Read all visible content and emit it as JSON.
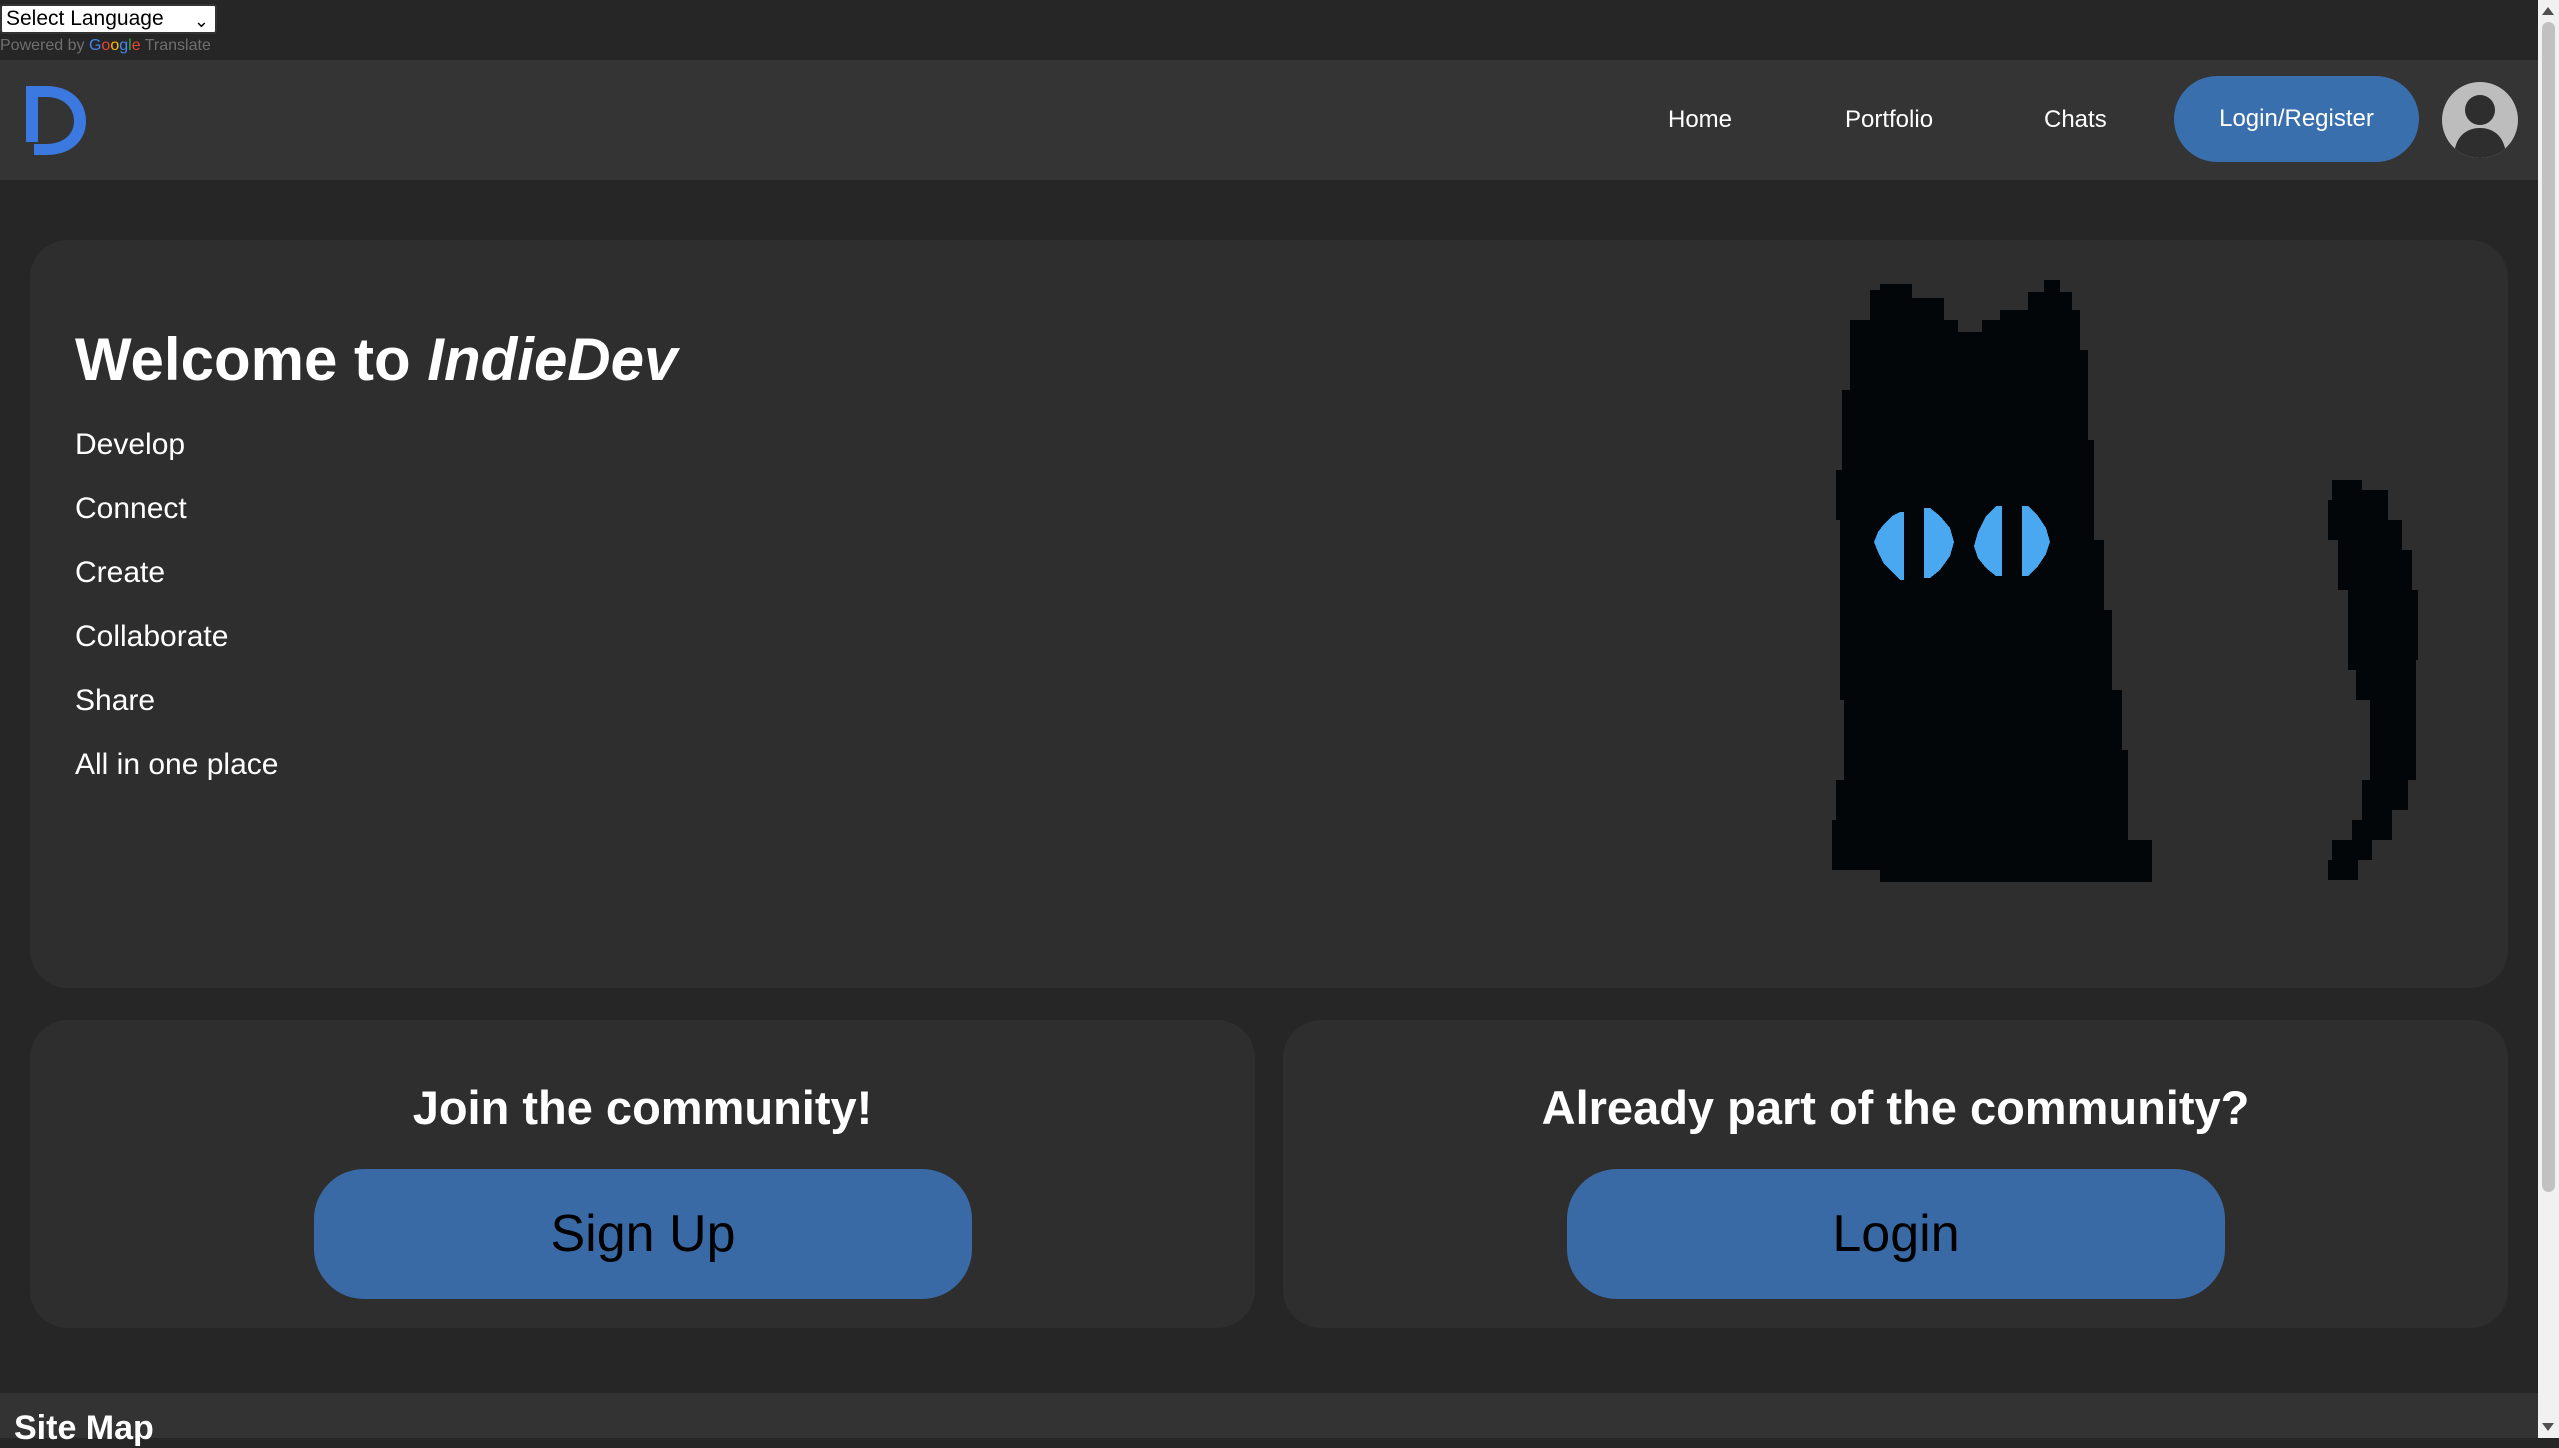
{
  "translate": {
    "select_label": "Select Language",
    "powered_by": "Powered by",
    "google_letters": [
      "G",
      "o",
      "o",
      "g",
      "l",
      "e"
    ],
    "translate_word": "Translate"
  },
  "nav": {
    "logo_icon": "indiedev-d-logo-icon",
    "links": [
      "Home",
      "Portfolio",
      "Chats"
    ],
    "login_register": "Login/Register",
    "avatar_icon": "user-avatar-icon",
    "accent_color": "#3a6fae"
  },
  "hero": {
    "title_prefix": "Welcome to ",
    "title_brand": "IndieDev",
    "features": [
      "Develop",
      "Connect",
      "Create",
      "Collaborate",
      "Share",
      "All in one place"
    ],
    "mascot_icon": "pixel-cat-icon",
    "mascot_eye_color": "#4aa8f0"
  },
  "community": {
    "join_heading": "Join the community!",
    "signup_label": "Sign Up",
    "member_heading": "Already part of the community?",
    "login_label": "Login",
    "button_color": "#3a6aa6"
  },
  "footer": {
    "title": "Site Map"
  }
}
